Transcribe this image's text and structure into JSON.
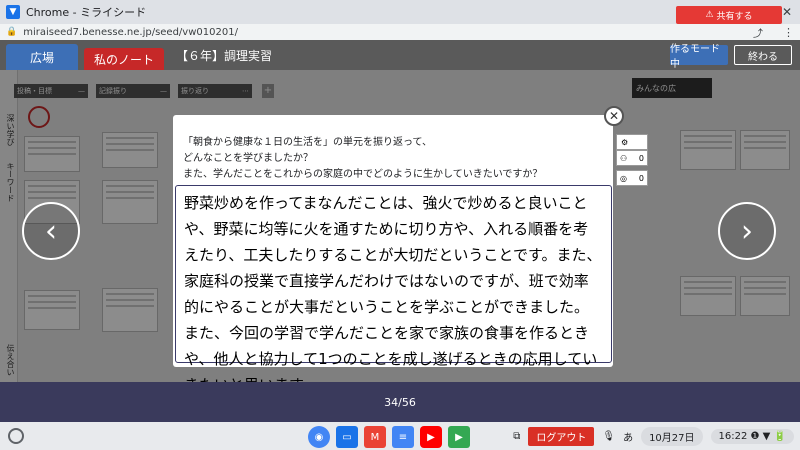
{
  "window": {
    "title": "Chrome - ミライシード"
  },
  "url": {
    "text": "miraiseed7.benesse.ne.jp/seed/vw010201/"
  },
  "appbar": {
    "tab_hiroba": "広場",
    "tab_note": "私のノート",
    "title": "【６年】調理実習",
    "mode_button": "作るモード中",
    "end_button": "終わる"
  },
  "workspace": {
    "side_labels": [
      "深い学び",
      "キーワード",
      "伝え合い"
    ],
    "columns": [
      "投稿・目標",
      "記録振り",
      "振り返り"
    ],
    "add_column": "+",
    "minna_label": "みんなの広",
    "share_button": "共有する"
  },
  "modal": {
    "question_lines": [
      "「朝食から健康な１日の生活を」の単元を振り返って、",
      "どんなことを学びましたか？",
      "また、学んだことをこれからの家庭の中でどのように生かしていきたいですか？"
    ],
    "answer": "野菜炒めを作ってまなんだことは、強火で炒めると良いことや、野菜に均等に火を通すために切り方や、入れる順番を考えたり、工夫したりすることが大切だということです。また、家庭科の授業で直接学んだわけではないのですが、班で効率的にやることが大事だということを学ぶことができました。また、今回の学習で学んだことを家で家族の食事を作るときや、他人と協力して1つのことを成し遂げるときの応用していきたいと思います。",
    "mini_counts": [
      "",
      "0",
      "0"
    ]
  },
  "pager": {
    "text": "34/56"
  },
  "shelf": {
    "logout": "ログアウト",
    "ime": "あ",
    "date": "10月27日",
    "time": "16:22"
  }
}
